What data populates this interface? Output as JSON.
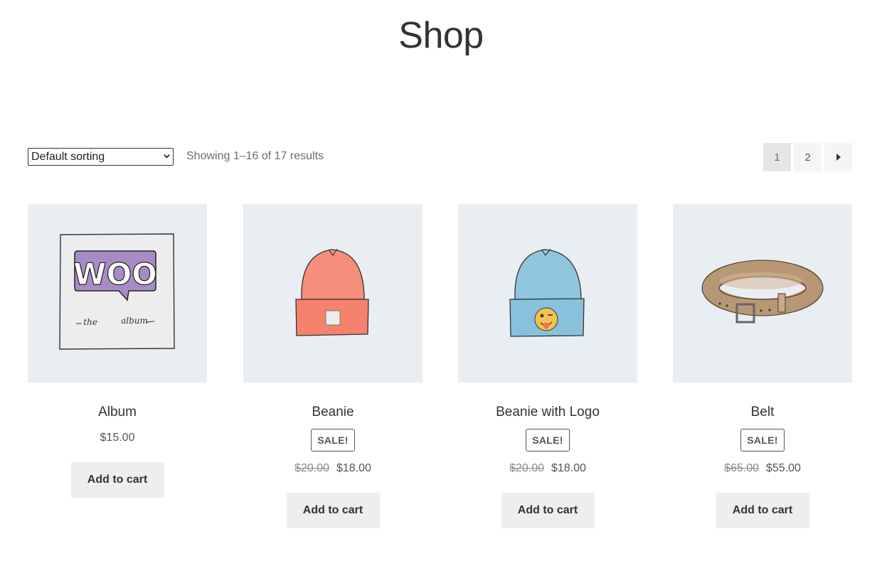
{
  "page": {
    "title": "Shop"
  },
  "toolbar": {
    "sort_selected": "Default sorting",
    "result_count": "Showing 1–16 of 17 results",
    "pages": [
      "1",
      "2"
    ],
    "current_page": "1"
  },
  "products": [
    {
      "name": "Album",
      "price": "$15.00",
      "add_to_cart": "Add to cart",
      "image_logo_text": "WOO",
      "image_caption_left": "the",
      "image_caption_right": "album"
    },
    {
      "name": "Beanie",
      "sale_badge": "SALE!",
      "old_price": "$20.00",
      "price": "$18.00",
      "add_to_cart": "Add to cart"
    },
    {
      "name": "Beanie with Logo",
      "sale_badge": "SALE!",
      "old_price": "$20.00",
      "price": "$18.00",
      "add_to_cart": "Add to cart"
    },
    {
      "name": "Belt",
      "sale_badge": "SALE!",
      "old_price": "$65.00",
      "price": "$55.00",
      "add_to_cart": "Add to cart"
    }
  ],
  "icons": {
    "sort_dropdown": "chevron-down-icon",
    "next_page": "caret-right-icon"
  },
  "colors": {
    "image_background": "#e9eef2",
    "button_background": "#eeeeee",
    "woo_purple": "#a88bc6",
    "beanie_orange": "#f58e7a",
    "beanie_blue": "#8fc6de",
    "belt_tan": "#c8a988"
  }
}
